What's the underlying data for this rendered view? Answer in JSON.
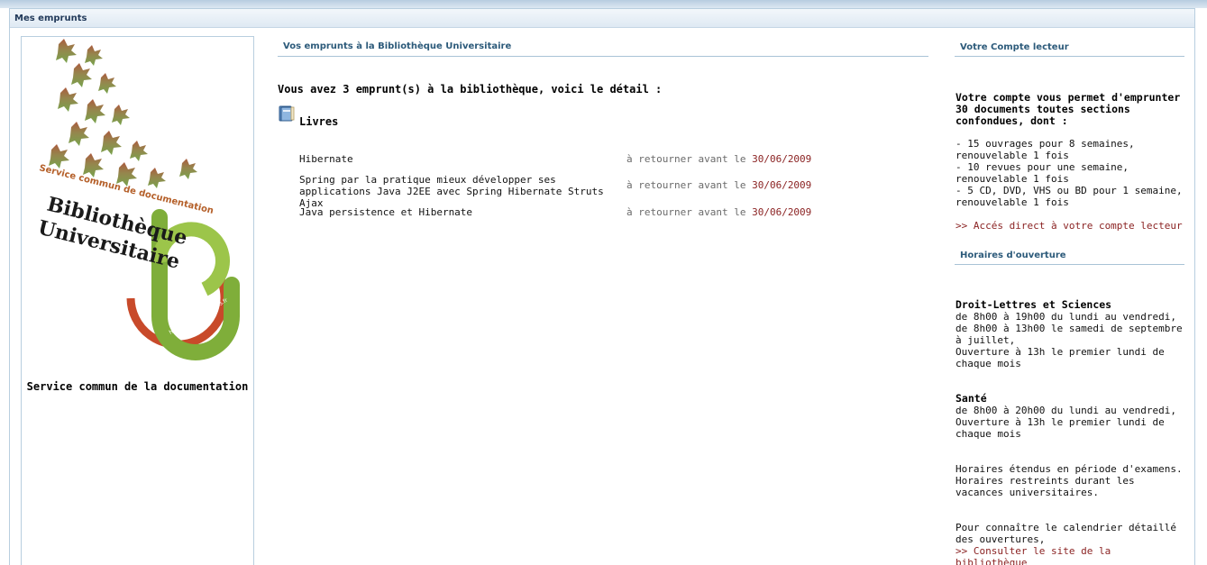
{
  "portlet": {
    "title": "Mes emprunts"
  },
  "left": {
    "logo_text": {
      "line1": "Service commun de documentation",
      "line2": "Bibliothèque",
      "line3": "Universitaire",
      "url": "http://scd.univ-lemans.fr"
    },
    "caption": "Service commun de la documentation"
  },
  "loans": {
    "section_title": "Vos emprunts à la Bibliothèque Universitaire",
    "intro": "Vous avez 3 emprunt(s) à la bibliothèque, voici le détail :",
    "category": "Livres",
    "due_prefix": "à retourner avant le",
    "items": [
      {
        "title": "Hibernate",
        "due": "30/06/2009"
      },
      {
        "title": "Spring par la pratique mieux développer ses applications Java J2EE avec Spring Hibernate Struts Ajax",
        "due": "30/06/2009"
      },
      {
        "title": "Java persistence et Hibernate",
        "due": "30/06/2009"
      }
    ]
  },
  "account": {
    "section_title": "Votre Compte lecteur",
    "intro": "Votre compte vous permet d'emprunter 30 documents toutes sections confondues, dont :",
    "rules": [
      "- 15 ouvrages pour 8 semaines, renouvelable 1 fois",
      "- 10 revues pour une semaine, renouvelable 1 fois",
      "- 5 CD, DVD, VHS ou BD pour 1 semaine, renouvelable 1 fois"
    ],
    "link": ">> Accés direct à votre compte lecteur"
  },
  "hours": {
    "section_title": "Horaires d'ouverture",
    "site1_name": "Droit-Lettres et Sciences",
    "site1_lines": [
      "de 8h00 à 19h00 du lundi au vendredi,",
      "de 8h00 à 13h00 le samedi de septembre à juillet,",
      "Ouverture à 13h le premier lundi de chaque mois"
    ],
    "site2_name": "Santé",
    "site2_lines": [
      "de 8h00 à 20h00 du lundi au vendredi,",
      "Ouverture à 13h le premier lundi de chaque mois"
    ],
    "notes": [
      "Horaires étendus en période d'examens.",
      "Horaires restreints durant les vacances universitaires."
    ],
    "calendar_text": "Pour connaître le calendrier détaillé des ouvertures,",
    "calendar_link": ">> Consulter le site de la bibliothèque"
  },
  "colors": {
    "accent_title": "#2c5a7a",
    "link": "#8b2323",
    "border": "#b8cedf"
  }
}
